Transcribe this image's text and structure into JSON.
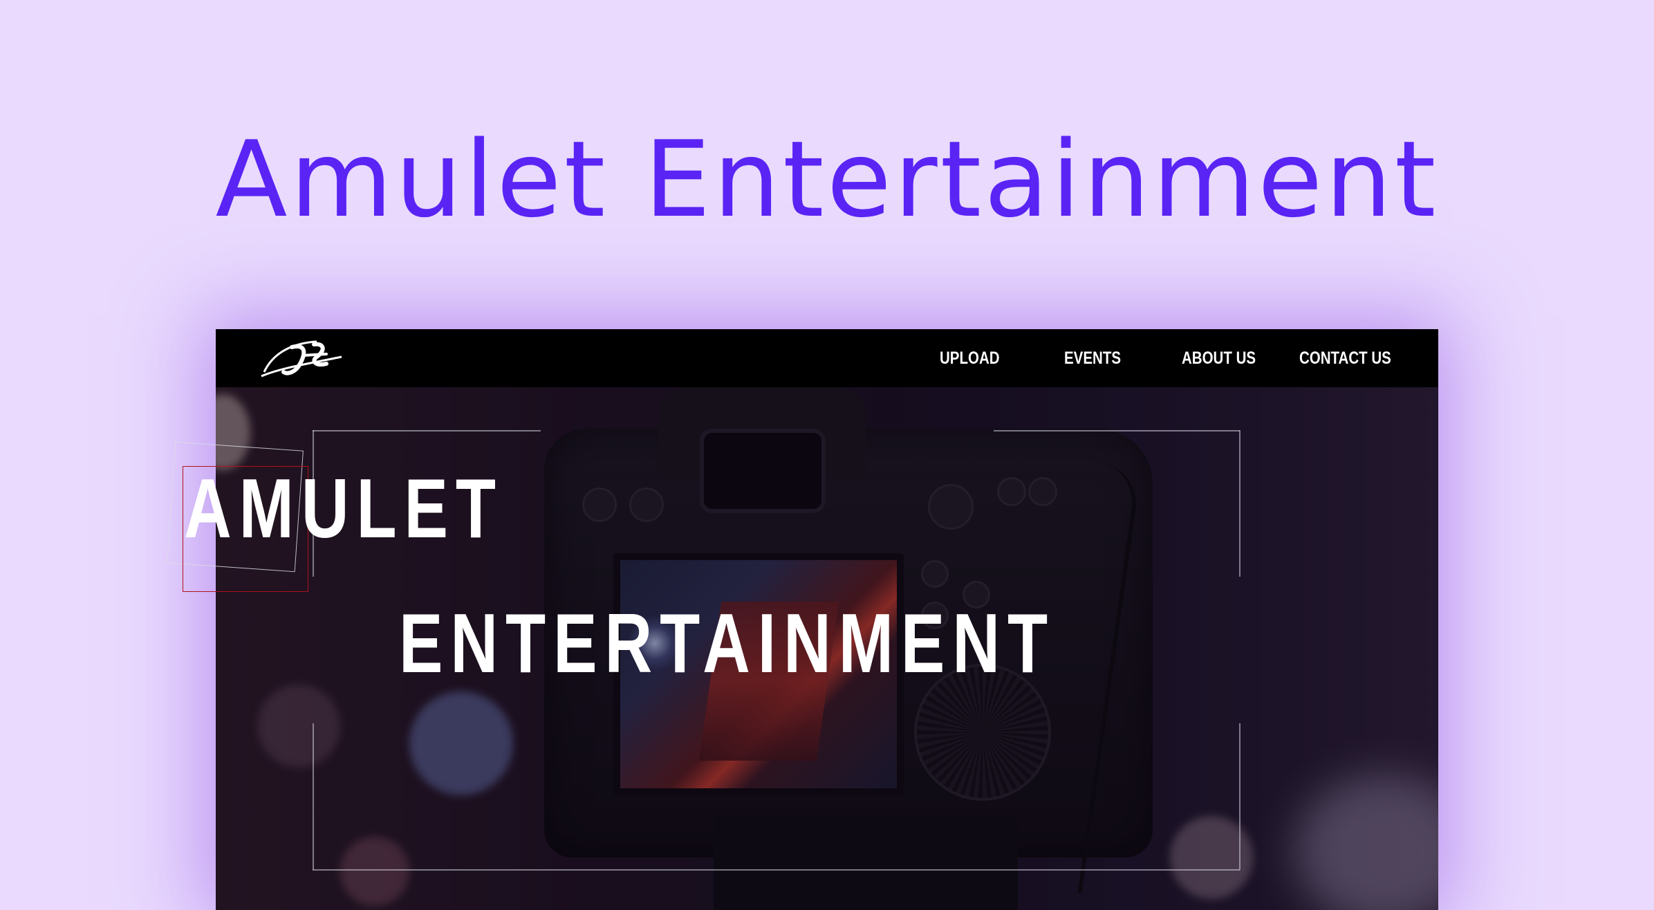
{
  "page": {
    "title": "Amulet Entertainment"
  },
  "site": {
    "logo": "JE",
    "nav": [
      {
        "label": "UPLOAD"
      },
      {
        "label": "EVENTS"
      },
      {
        "label": "ABOUT US"
      },
      {
        "label": "CONTACT US"
      }
    ],
    "hero": {
      "line1": "AMULET",
      "line2": "ENTERTAINMENT"
    }
  },
  "colors": {
    "background": "#e9dafe",
    "title": "#5a24f5",
    "navbar": "#000000",
    "accent_red": "#b0121c"
  }
}
